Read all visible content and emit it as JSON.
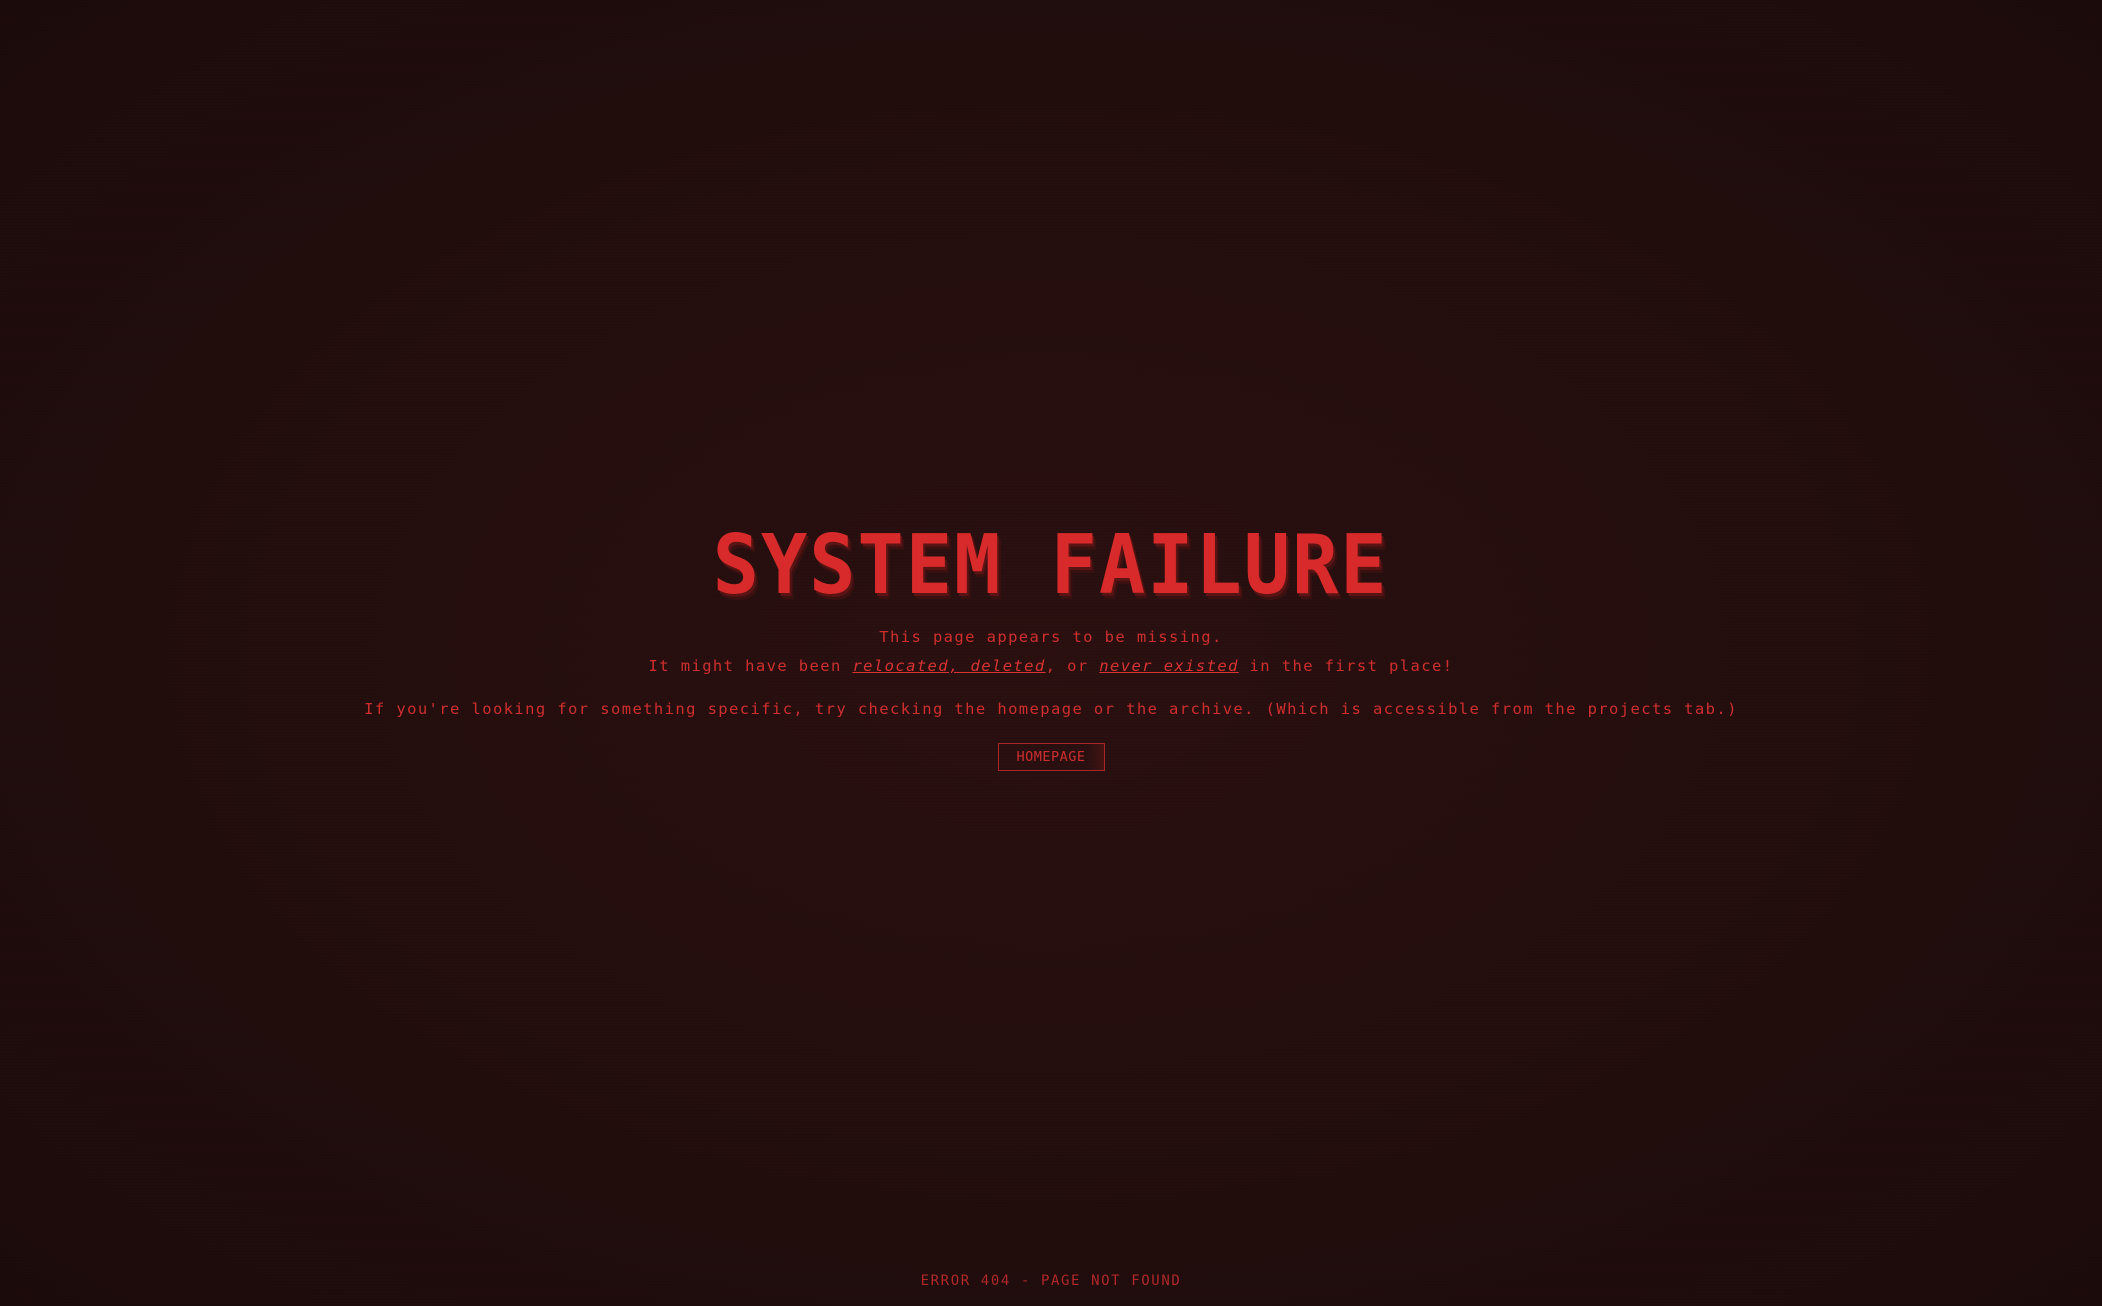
{
  "page": {
    "title": "SYSTEM FAILURE",
    "line1": "This page appears to be missing.",
    "line2_prefix": "It might have been ",
    "link_relocated": "relocated",
    "sep1": ", ",
    "link_deleted": "deleted",
    "sep2": ", or ",
    "link_never_existed": "never existed",
    "line2_suffix": " in the first place!",
    "line3": "If you're looking for something specific, try checking the homepage or the archive. (Which is accessible from the projects tab.)",
    "homepage_button": "HOMEPAGE",
    "footer": "ERROR 404 - PAGE NOT FOUND"
  },
  "colors": {
    "background": "#260f0f",
    "accent": "#d62b2b"
  }
}
